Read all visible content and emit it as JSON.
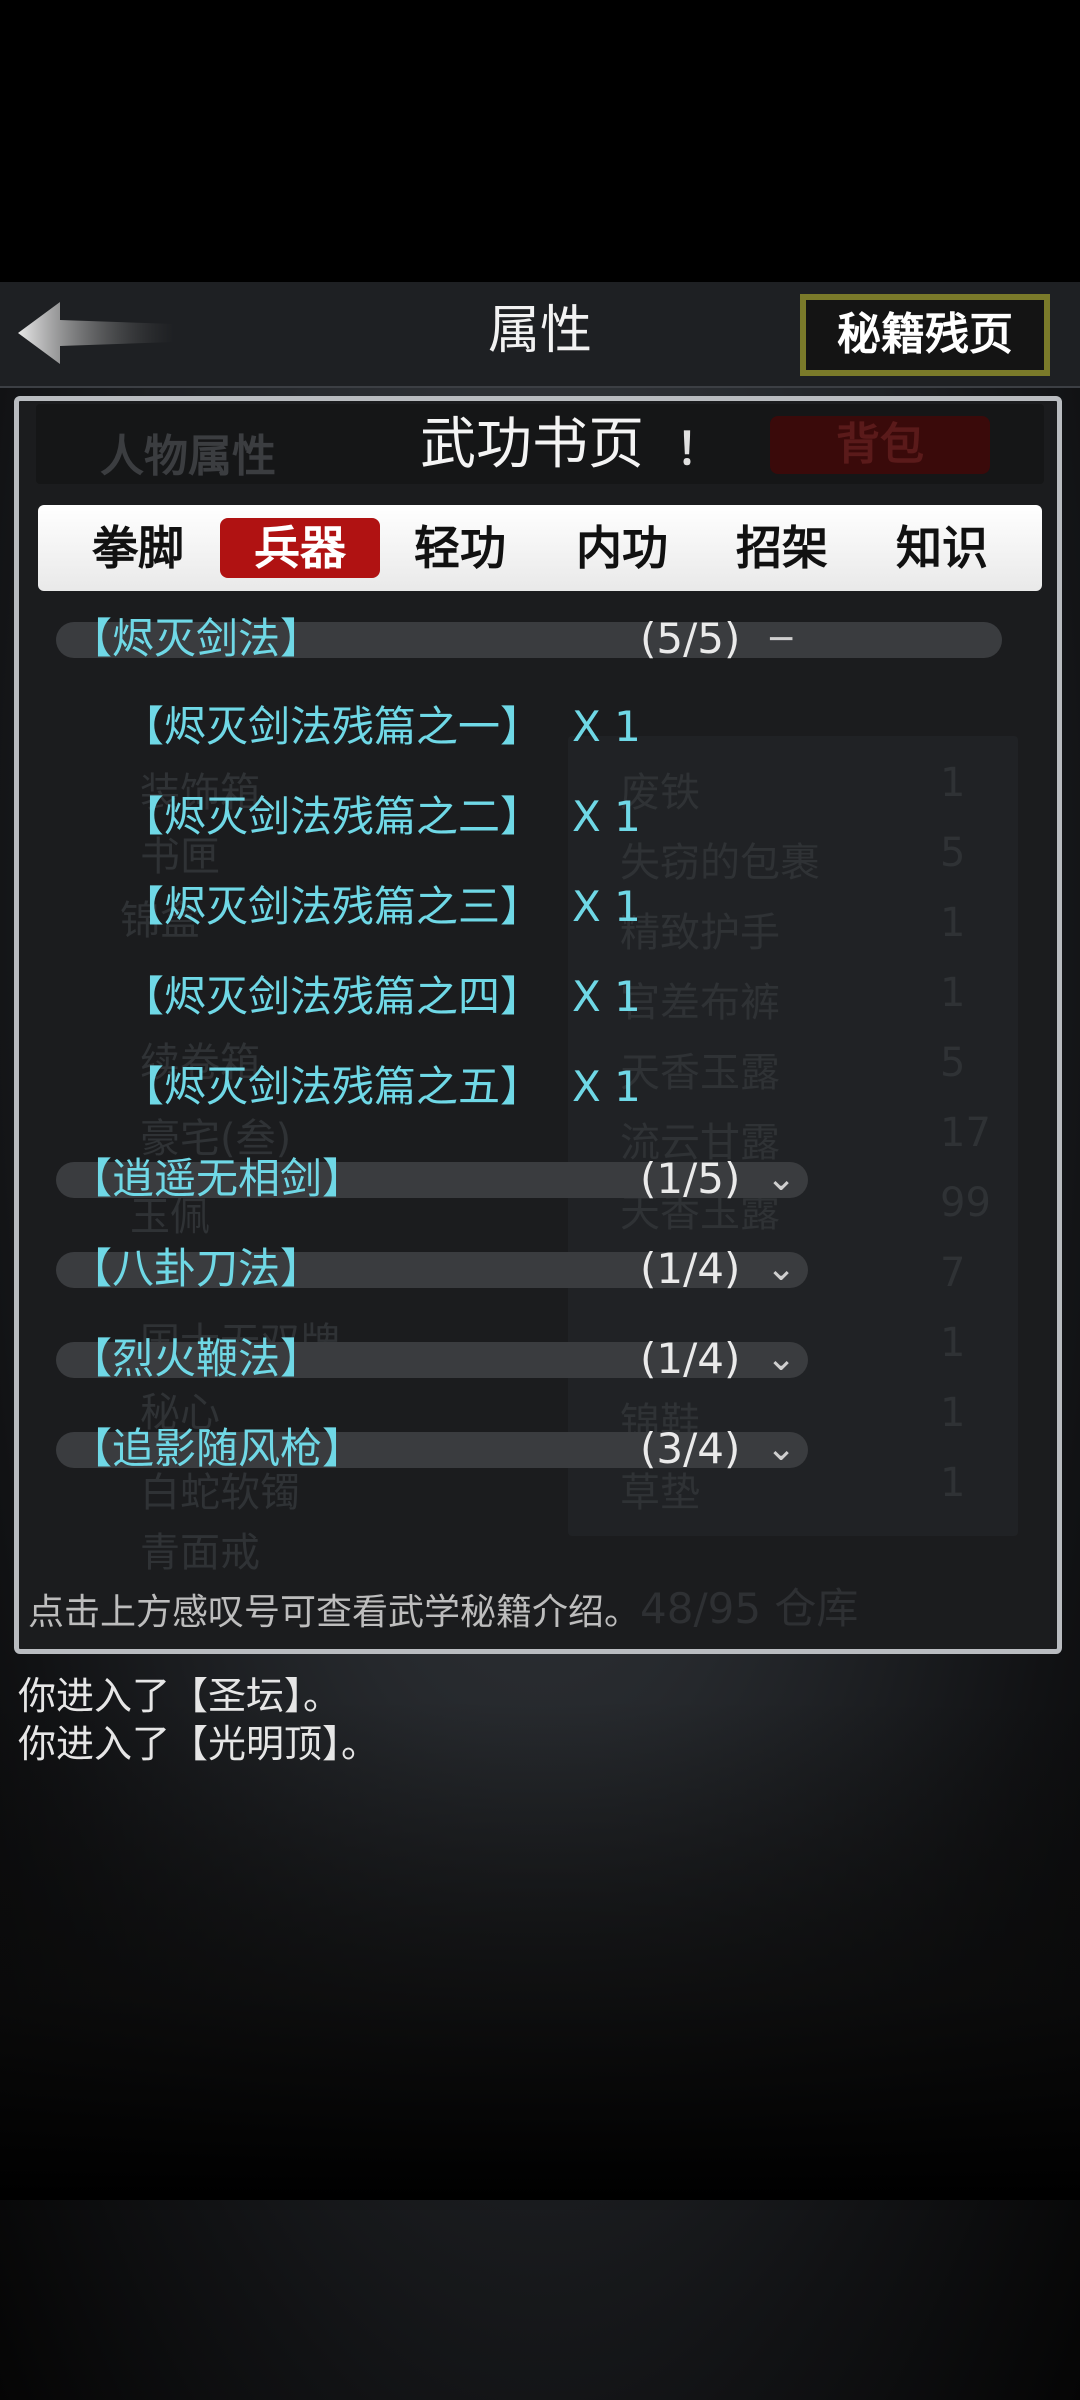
{
  "header": {
    "title": "属性",
    "fragments_button": "秘籍残页"
  },
  "panel": {
    "ghost_left_tab": "人物属性",
    "title": "武功书页",
    "info_icon": "！",
    "ghost_right_tab": "背包",
    "tabs": [
      {
        "label": "拳脚",
        "active": false
      },
      {
        "label": "兵器",
        "active": true
      },
      {
        "label": "轻功",
        "active": false
      },
      {
        "label": "内功",
        "active": false
      },
      {
        "label": "招架",
        "active": false
      },
      {
        "label": "知识",
        "active": false
      }
    ],
    "groups": [
      {
        "name": "【烬灭剑法】",
        "progress": "(5/5)",
        "expanded": true,
        "toggle": "−",
        "items": [
          {
            "name": "【烬灭剑法残篇之一】",
            "qty": "X 1"
          },
          {
            "name": "【烬灭剑法残篇之二】",
            "qty": "X 1"
          },
          {
            "name": "【烬灭剑法残篇之三】",
            "qty": "X 1"
          },
          {
            "name": "【烬灭剑法残篇之四】",
            "qty": "X 1"
          },
          {
            "name": "【烬灭剑法残篇之五】",
            "qty": "X 1"
          }
        ]
      },
      {
        "name": "【逍遥无相剑】",
        "progress": "(1/5)",
        "expanded": false,
        "toggle": "⌄"
      },
      {
        "name": "【八卦刀法】",
        "progress": "(1/4)",
        "expanded": false,
        "toggle": "⌄"
      },
      {
        "name": "【烈火鞭法】",
        "progress": "(1/4)",
        "expanded": false,
        "toggle": "⌄"
      },
      {
        "name": "【追影随风枪】",
        "progress": "(3/4)",
        "expanded": false,
        "toggle": "⌄"
      }
    ],
    "hint": "点击上方感叹号可查看武学秘籍介绍。",
    "ghost_storage": "48/95 仓库"
  },
  "background_ghost": {
    "left_items": [
      "装饰箱",
      "书匣",
      "锦盒",
      "续卷箱",
      "豪宅(叁)",
      "玉佩",
      "国士无双牌",
      "秘心",
      "白蛇软镯",
      "青面戒"
    ],
    "right_items": [
      {
        "name": "废铁",
        "qty": "1"
      },
      {
        "name": "失窃的包裹",
        "qty": "5"
      },
      {
        "name": "精致护手",
        "qty": "1"
      },
      {
        "name": "官差布裤",
        "qty": "1"
      },
      {
        "name": "天香玉露",
        "qty": "5"
      },
      {
        "name": "流云甘露",
        "qty": "17"
      },
      {
        "name": "天香玉露",
        "qty": "99"
      },
      {
        "name": "",
        "qty": "7"
      },
      {
        "name": "",
        "qty": "1"
      },
      {
        "name": "锦鞋",
        "qty": "1"
      },
      {
        "name": "草垫",
        "qty": "1"
      }
    ]
  },
  "log": [
    "你进入了【圣坛】。",
    "你进入了【光明顶】。"
  ],
  "colors": {
    "accent_cyan": "#6fd8e6",
    "active_tab": "#b01212",
    "button_border": "#7a7a2a"
  }
}
